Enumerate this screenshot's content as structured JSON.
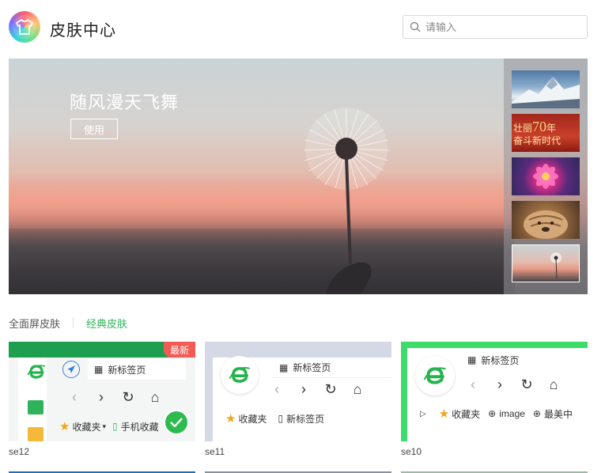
{
  "header": {
    "title": "皮肤中心",
    "search_placeholder": "请输入"
  },
  "banner": {
    "title": "随风漫天飞舞",
    "use_label": "使用",
    "thumbnails": [
      {
        "name": "snow-mountain"
      },
      {
        "name": "new-era",
        "text_line1": "壮丽",
        "text_big": "70",
        "text_after": "年",
        "text_line2": "奋斗新时代"
      },
      {
        "name": "pink-flower"
      },
      {
        "name": "shar-pei-dog"
      },
      {
        "name": "dandelion",
        "selected": true
      }
    ]
  },
  "tabs": [
    {
      "label": "全面屏皮肤",
      "active": false
    },
    {
      "label": "经典皮肤",
      "active": true
    }
  ],
  "cards": [
    {
      "name": "se12",
      "badge": "最新",
      "tab_label": "新标签页",
      "fav_label": "收藏夹",
      "fav_extra": "手机收藏",
      "selected": true,
      "color": "#1e9e4f"
    },
    {
      "name": "se11",
      "tab_label": "新标签页",
      "fav_label": "收藏夹",
      "fav_extra": "新标签页",
      "color": "#d5d9e6"
    },
    {
      "name": "se10",
      "tab_label": "新标签页",
      "fav_label": "收藏夹",
      "fav_extra": "image",
      "fav_extra2": "最美中",
      "color": "#3ddc6a"
    }
  ],
  "colors": {
    "accent": "#2fb35a",
    "badge": "#f45b55"
  }
}
